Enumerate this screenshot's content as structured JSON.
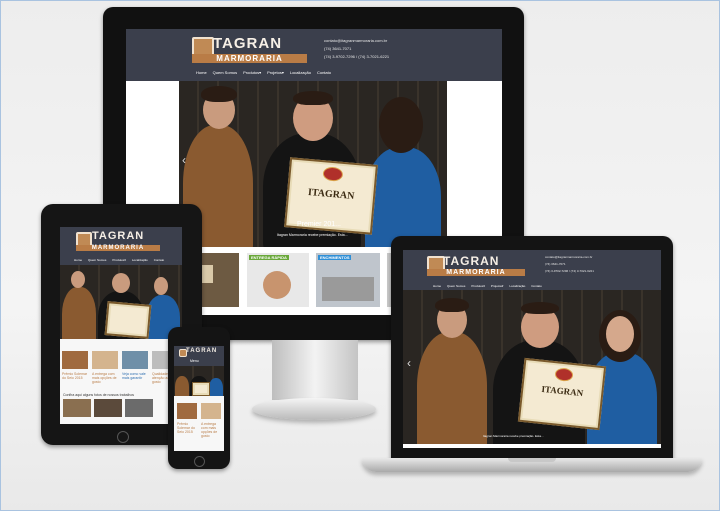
{
  "brand": {
    "name": "TAGRAN",
    "sub": "MARMORARIA",
    "mark": "I"
  },
  "contact": {
    "email": "contato@itagranmarmoraria.com.br",
    "phone1": "(74) 3641-7071",
    "phone2": "(74) 3-9702-7296 / (74) 3-7021-6221"
  },
  "nav": [
    "Home",
    "Quem Somos",
    "Produtos▾",
    "Projetos▾",
    "Localização",
    "Contato"
  ],
  "slide": {
    "caption": "Premier 201...",
    "sub_caption": "Itagran Marmoraria recebe premiação. Esta...",
    "certificate": "ITAGRAN",
    "banner_text": "PREMIER"
  },
  "tiles": {
    "t1": "",
    "t2": "ENTREGA RÁPIDA",
    "t3": "ENCHIMENTOS"
  },
  "tablet": {
    "links": [
      "Prêmio Solemar do Seio 2015",
      "A entrega com mais opções de gosto",
      "Veja como vale mais garantir",
      "Qualidade e atenção ao seu gosto"
    ],
    "section": "Confira aqui alguns fotos de nossos trabalhos"
  },
  "phone": {
    "menu": "Menu",
    "links": [
      "Prêmio Solemar do Seio 2015",
      "A entrega com mais opções de gosto"
    ]
  },
  "colors": {
    "header": "#3b3f4c",
    "accent": "#b97c46"
  }
}
